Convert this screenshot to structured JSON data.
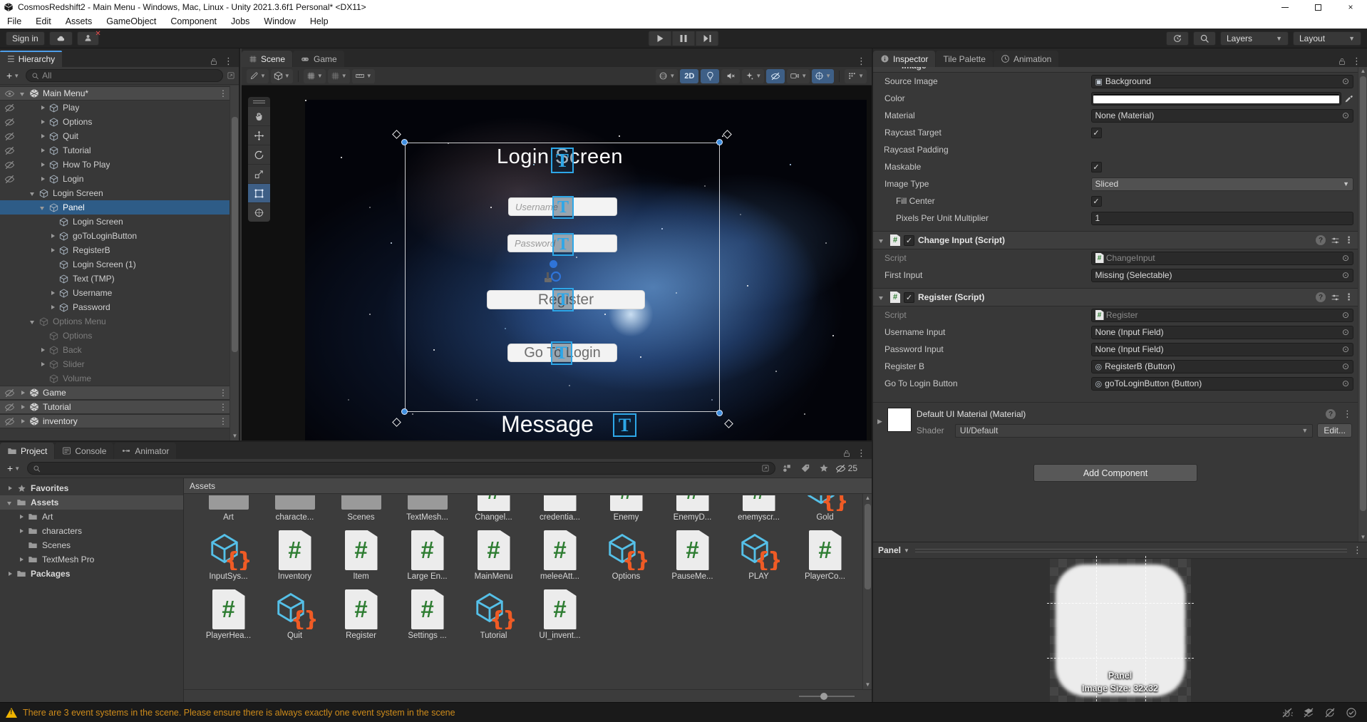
{
  "window": {
    "title": "CosmosRedshift2 - Main Menu - Windows, Mac, Linux - Unity 2021.3.6f1 Personal* <DX11>"
  },
  "menubar": [
    "File",
    "Edit",
    "Assets",
    "GameObject",
    "Component",
    "Jobs",
    "Window",
    "Help"
  ],
  "toolbar": {
    "sign_in": "Sign in",
    "layers": "Layers",
    "layout": "Layout"
  },
  "hierarchy": {
    "tab": "Hierarchy",
    "add_button": "+",
    "search_placeholder": "All",
    "items": [
      {
        "label": "Main Menu*",
        "depth": 0,
        "arrow": "down",
        "icon": "scene",
        "header": true,
        "eye": "on",
        "kebab": true
      },
      {
        "label": "Play",
        "depth": 2,
        "arrow": "right",
        "icon": "cube",
        "eye": "off"
      },
      {
        "label": "Options",
        "depth": 2,
        "arrow": "right",
        "icon": "cube",
        "eye": "off"
      },
      {
        "label": "Quit",
        "depth": 2,
        "arrow": "right",
        "icon": "cube",
        "eye": "off"
      },
      {
        "label": "Tutorial",
        "depth": 2,
        "arrow": "right",
        "icon": "cube",
        "eye": "off"
      },
      {
        "label": "How To Play",
        "depth": 2,
        "arrow": "right",
        "icon": "cube",
        "eye": "off"
      },
      {
        "label": "Login",
        "depth": 2,
        "arrow": "right",
        "icon": "cube",
        "eye": "off"
      },
      {
        "label": "Login Screen",
        "depth": 1,
        "arrow": "down",
        "icon": "cube"
      },
      {
        "label": "Panel",
        "depth": 2,
        "arrow": "down",
        "icon": "cube",
        "selected": true
      },
      {
        "label": "Login Screen",
        "depth": 3,
        "icon": "cube"
      },
      {
        "label": "goToLoginButton",
        "depth": 3,
        "arrow": "right",
        "icon": "cube"
      },
      {
        "label": "RegisterB",
        "depth": 3,
        "arrow": "right",
        "icon": "cube"
      },
      {
        "label": "Login Screen (1)",
        "depth": 3,
        "icon": "cube"
      },
      {
        "label": "Text (TMP)",
        "depth": 3,
        "icon": "cube"
      },
      {
        "label": "Username",
        "depth": 3,
        "arrow": "right",
        "icon": "cube"
      },
      {
        "label": "Password",
        "depth": 3,
        "arrow": "right",
        "icon": "cube"
      },
      {
        "label": "Options Menu",
        "depth": 1,
        "arrow": "down",
        "icon": "cube",
        "dim": true
      },
      {
        "label": "Options",
        "depth": 2,
        "icon": "cube",
        "dim": true
      },
      {
        "label": "Back",
        "depth": 2,
        "arrow": "right",
        "icon": "cube",
        "dim": true
      },
      {
        "label": "Slider",
        "depth": 2,
        "arrow": "right",
        "icon": "cube",
        "dim": true
      },
      {
        "label": "Volume",
        "depth": 2,
        "icon": "cube",
        "dim": true
      },
      {
        "label": "Game",
        "depth": 0,
        "arrow": "right",
        "icon": "scene",
        "header": true,
        "eye": "off",
        "kebab": true
      },
      {
        "label": "Tutorial",
        "depth": 0,
        "arrow": "right",
        "icon": "scene",
        "header": true,
        "eye": "off",
        "kebab": true
      },
      {
        "label": "inventory",
        "depth": 0,
        "arrow": "right",
        "icon": "scene",
        "header": true,
        "eye": "off",
        "kebab": true
      }
    ]
  },
  "scene": {
    "tabs": [
      {
        "label": "Scene",
        "icon": "grid",
        "active": true
      },
      {
        "label": "Game",
        "icon": "gamepad"
      }
    ],
    "toolbar_2d": "2D",
    "canvas": {
      "title": "Login Screen",
      "username_placeholder": "Username",
      "password_placeholder": "Password",
      "register_button": "Register",
      "go_to_login_button": "Go To Login",
      "message": "Message"
    }
  },
  "project": {
    "tabs": [
      {
        "label": "Project",
        "icon": "folder",
        "active": true
      },
      {
        "label": "Console",
        "icon": "console"
      },
      {
        "label": "Animator",
        "icon": "anim"
      }
    ],
    "add_button": "+",
    "hidden_count": "25",
    "location_label": "Assets",
    "tree": [
      {
        "label": "Favorites",
        "icon": "star",
        "arrow": "right",
        "depth": 0
      },
      {
        "label": "Assets",
        "icon": "folder",
        "arrow": "down",
        "depth": 0,
        "selected": true
      },
      {
        "label": "Art",
        "icon": "folder",
        "arrow": "right",
        "depth": 1
      },
      {
        "label": "characters",
        "icon": "folder",
        "arrow": "right",
        "depth": 1
      },
      {
        "label": "Scenes",
        "icon": "folder",
        "depth": 1
      },
      {
        "label": "TextMesh Pro",
        "icon": "folder",
        "arrow": "right",
        "depth": 1
      },
      {
        "label": "Packages",
        "icon": "folder",
        "arrow": "right",
        "depth": 0
      }
    ],
    "assets": [
      {
        "label": "Art",
        "icon": "folder",
        "clipped": true
      },
      {
        "label": "characte...",
        "icon": "folder",
        "clipped": true
      },
      {
        "label": "Scenes",
        "icon": "folder",
        "clipped": true
      },
      {
        "label": "TextMesh...",
        "icon": "folder",
        "clipped": true
      },
      {
        "label": "Changel...",
        "icon": "script",
        "clipped": true
      },
      {
        "label": "credentia...",
        "icon": "doc",
        "clipped": true
      },
      {
        "label": "Enemy",
        "icon": "script",
        "clipped": true
      },
      {
        "label": "EnemyD...",
        "icon": "script",
        "clipped": true
      },
      {
        "label": "enemyscr...",
        "icon": "script",
        "clipped": true
      },
      {
        "label": "Gold",
        "icon": "cubebraces",
        "clipped": true
      },
      {
        "label": "InputSys...",
        "icon": "cubebraces"
      },
      {
        "label": "Inventory",
        "icon": "script"
      },
      {
        "label": "Item",
        "icon": "script"
      },
      {
        "label": "Large En...",
        "icon": "script"
      },
      {
        "label": "MainMenu",
        "icon": "script"
      },
      {
        "label": "meleeAtt...",
        "icon": "script"
      },
      {
        "label": "Options",
        "icon": "cubebraces"
      },
      {
        "label": "PauseMe...",
        "icon": "script"
      },
      {
        "label": "PLAY",
        "icon": "cubebraces"
      },
      {
        "label": "PlayerCo...",
        "icon": "script"
      },
      {
        "label": "PlayerHea...",
        "icon": "script"
      },
      {
        "label": "Quit",
        "icon": "cubebraces"
      },
      {
        "label": "Register",
        "icon": "script"
      },
      {
        "label": "Settings ...",
        "icon": "script"
      },
      {
        "label": "Tutorial",
        "icon": "cubebraces"
      },
      {
        "label": "UI_invent...",
        "icon": "script"
      }
    ]
  },
  "inspector": {
    "tabs": [
      {
        "label": "Inspector",
        "icon": "info",
        "active": true
      },
      {
        "label": "Tile Palette"
      },
      {
        "label": "Animation",
        "icon": "clock"
      }
    ],
    "clipped_component": "Image",
    "image_component": {
      "rows": [
        {
          "label": "Source Image",
          "type": "object",
          "value": "Background",
          "icon": "image"
        },
        {
          "label": "Color",
          "type": "color"
        },
        {
          "label": "Material",
          "type": "object",
          "value": "None (Material)"
        },
        {
          "label": "Raycast Target",
          "type": "check",
          "checked": true
        },
        {
          "label": "Raycast Padding",
          "type": "foldout"
        },
        {
          "label": "Maskable",
          "type": "check",
          "checked": true
        },
        {
          "label": "Image Type",
          "type": "dropdown",
          "value": "Sliced"
        },
        {
          "label": "Fill Center",
          "type": "check",
          "checked": true,
          "indent": 1
        },
        {
          "label": "Pixels Per Unit Multiplier",
          "type": "text",
          "value": "1",
          "indent": 1
        }
      ]
    },
    "components": [
      {
        "title": "Change Input (Script)",
        "rows": [
          {
            "label": "Script",
            "type": "object",
            "value": "ChangeInput",
            "icon": "script",
            "disabled": true
          },
          {
            "label": "First Input",
            "type": "object",
            "value": "Missing (Selectable)"
          }
        ]
      },
      {
        "title": "Register (Script)",
        "rows": [
          {
            "label": "Script",
            "type": "object",
            "value": "Register",
            "icon": "script",
            "disabled": true
          },
          {
            "label": "Username Input",
            "type": "object",
            "value": "None (Input Field)"
          },
          {
            "label": "Password Input",
            "type": "object",
            "value": "None (Input Field)"
          },
          {
            "label": "Register B",
            "type": "object",
            "value": "RegisterB (Button)",
            "icon": "dot"
          },
          {
            "label": "Go To Login Button",
            "type": "object",
            "value": "goToLoginButton (Button)",
            "icon": "dot"
          }
        ]
      }
    ],
    "material": {
      "title": "Default UI Material (Material)",
      "shader_label": "Shader",
      "shader_value": "UI/Default",
      "edit_button": "Edit..."
    },
    "add_component": "Add Component",
    "preview": {
      "header": "Panel",
      "sprite_name": "Panel",
      "image_size": "Image Size: 32x32"
    }
  },
  "statusbar": {
    "warning": "There are 3 event systems in the scene. Please ensure there is always exactly one event system in the scene"
  }
}
